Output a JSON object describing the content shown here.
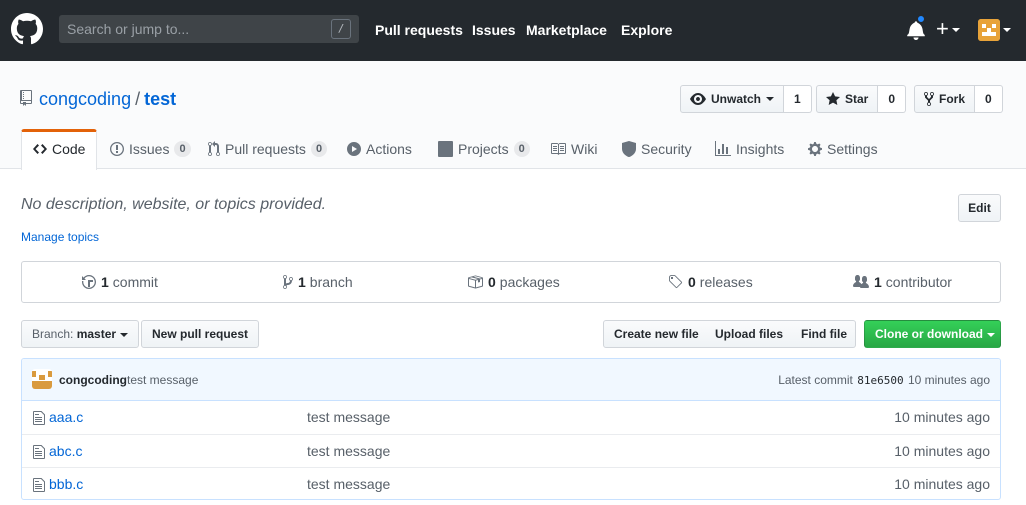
{
  "header": {
    "search_placeholder": "Search or jump to...",
    "search_key": "/",
    "nav": [
      "Pull requests",
      "Issues",
      "Marketplace",
      "Explore"
    ],
    "plus_label": "+"
  },
  "repo": {
    "owner": "congcoding",
    "separator": "/",
    "name": "test",
    "watch_label": "Unwatch",
    "watch_count": "1",
    "star_label": "Star",
    "star_count": "0",
    "fork_label": "Fork",
    "fork_count": "0"
  },
  "tabs": [
    {
      "label": "Code"
    },
    {
      "label": "Issues",
      "count": "0"
    },
    {
      "label": "Pull requests",
      "count": "0"
    },
    {
      "label": "Actions"
    },
    {
      "label": "Projects",
      "count": "0"
    },
    {
      "label": "Wiki"
    },
    {
      "label": "Security"
    },
    {
      "label": "Insights"
    },
    {
      "label": "Settings"
    }
  ],
  "about": {
    "description": "No description, website, or topics provided.",
    "edit_label": "Edit",
    "topics_link": "Manage topics"
  },
  "summary": [
    {
      "count": "1",
      "label": "commit"
    },
    {
      "count": "1",
      "label": "branch"
    },
    {
      "count": "0",
      "label": "packages"
    },
    {
      "count": "0",
      "label": "releases"
    },
    {
      "count": "1",
      "label": "contributor"
    }
  ],
  "toolbar": {
    "branch_prefix": "Branch:",
    "branch_name": "master",
    "new_pr": "New pull request",
    "create_file": "Create new file",
    "upload_files": "Upload files",
    "find_file": "Find file",
    "clone": "Clone or download"
  },
  "latest_commit": {
    "author": "congcoding",
    "message": "test message",
    "prefix": "Latest commit",
    "sha": "81e6500",
    "age": "10 minutes ago"
  },
  "files": [
    {
      "name": "aaa.c",
      "message": "test message",
      "age": "10 minutes ago"
    },
    {
      "name": "abc.c",
      "message": "test message",
      "age": "10 minutes ago"
    },
    {
      "name": "bbb.c",
      "message": "test message",
      "age": "10 minutes ago"
    }
  ],
  "colors": {
    "header_bg": "#24292e",
    "link": "#0366d6",
    "tab_accent": "#e36209",
    "clone_green": "#28a745",
    "commit_bar": "#f1f8ff",
    "notification_dot": "#2188ff"
  }
}
